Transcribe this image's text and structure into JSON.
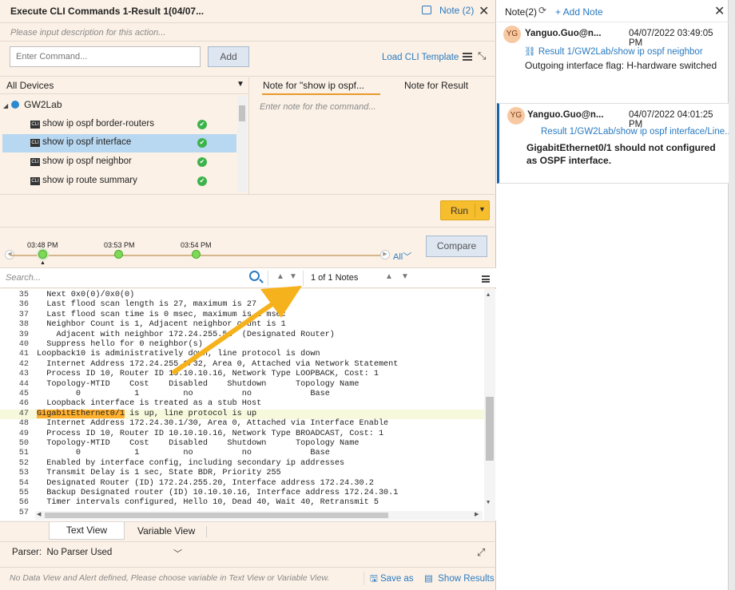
{
  "window": {
    "title": "Execute CLI Commands 1-Result 1(04/07...",
    "note_button": "Note (2)"
  },
  "description_placeholder": "Please input description for this action...",
  "command": {
    "placeholder": "Enter Command...",
    "add_label": "Add",
    "load_template": "Load CLI Template"
  },
  "devices": {
    "dropdown_label": "All Devices",
    "root": "GW2Lab",
    "items": [
      {
        "label": "show ip ospf border-routers",
        "selected": false
      },
      {
        "label": "show ip ospf interface",
        "selected": true
      },
      {
        "label": "show ip ospf neighbor",
        "selected": false
      },
      {
        "label": "show ip route summary",
        "selected": false
      }
    ]
  },
  "note_tabs": {
    "tab1": "Note for \"show ip ospf...",
    "tab2": "Note for Result",
    "placeholder": "Enter note for the command..."
  },
  "run_label": "Run",
  "timeline": {
    "times": [
      "03:48 PM",
      "03:53 PM",
      "03:54 PM"
    ],
    "all_label": "All"
  },
  "compare_label": "Compare",
  "search": {
    "placeholder": "Search...",
    "notes_count": "1 of 1 Notes"
  },
  "code_lines": [
    {
      "n": "35",
      "t": "  Next 0x0(0)/0x0(0)"
    },
    {
      "n": "36",
      "t": "  Last flood scan length is 27, maximum is 27"
    },
    {
      "n": "37",
      "t": "  Last flood scan time is 0 msec, maximum is 2 msec"
    },
    {
      "n": "38",
      "t": "  Neighbor Count is 1, Adjacent neighbor count is 1"
    },
    {
      "n": "39",
      "t": "    Adjacent with neighbor 172.24.255.51  (Designated Router)"
    },
    {
      "n": "40",
      "t": "  Suppress hello for 0 neighbor(s)"
    },
    {
      "n": "41",
      "t": "Loopback10 is administratively down, line protocol is down"
    },
    {
      "n": "42",
      "t": "  Internet Address 172.24.255.1/32, Area 0, Attached via Network Statement"
    },
    {
      "n": "43",
      "t": "  Process ID 10, Router ID 10.10.10.16, Network Type LOOPBACK, Cost: 1"
    },
    {
      "n": "44",
      "t": "  Topology-MTID    Cost    Disabled    Shutdown      Topology Name"
    },
    {
      "n": "45",
      "t": "        0           1         no          no            Base"
    },
    {
      "n": "46",
      "t": "  Loopback interface is treated as a stub Host"
    },
    {
      "n": "47",
      "t": " is up, line protocol is up",
      "hw": "GigabitEthernet0/1"
    },
    {
      "n": "48",
      "t": "  Internet Address 172.24.30.1/30, Area 0, Attached via Interface Enable"
    },
    {
      "n": "49",
      "t": "  Process ID 10, Router ID 10.10.10.16, Network Type BROADCAST, Cost: 1"
    },
    {
      "n": "50",
      "t": "  Topology-MTID    Cost    Disabled    Shutdown      Topology Name"
    },
    {
      "n": "51",
      "t": "        0           1         no          no            Base"
    },
    {
      "n": "52",
      "t": "  Enabled by interface config, including secondary ip addresses"
    },
    {
      "n": "53",
      "t": "  Transmit Delay is 1 sec, State BDR, Priority 255"
    },
    {
      "n": "54",
      "t": "  Designated Router (ID) 172.24.255.20, Interface address 172.24.30.2"
    },
    {
      "n": "55",
      "t": "  Backup Designated router (ID) 10.10.10.16, Interface address 172.24.30.1"
    },
    {
      "n": "56",
      "t": "  Timer intervals configured, Hello 10, Dead 40, Wait 40, Retransmit 5"
    },
    {
      "n": "57",
      "t": ""
    }
  ],
  "view_tabs": {
    "text_view": "Text View",
    "variable_view": "Variable View"
  },
  "parser": {
    "label": "Parser:",
    "value": "No Parser Used"
  },
  "footer": {
    "message": "No Data View and Alert defined, Please choose variable in Text View or Variable View.",
    "save_as": "Save as",
    "show_results": "Show Results"
  },
  "notes_panel": {
    "title": "Note(2)",
    "add_note": "+ Add Note",
    "notes": [
      {
        "initials": "YG",
        "user": "Yanguo.Guo@n...",
        "date": "04/07/2022 03:49:05 PM",
        "link": "Result 1/GW2Lab/show ip ospf neighbor",
        "text": "Outgoing interface flag: H-hardware switched"
      },
      {
        "initials": "YG",
        "user": "Yanguo.Guo@n...",
        "date": "04/07/2022 04:01:25 PM",
        "link": "Result 1/GW2Lab/show ip ospf interface/Line...",
        "text1": "GigabitEthernet0/1 should not configured",
        "text2": "as OSPF interface."
      }
    ]
  },
  "colors": {
    "accent": "#2a7ac0",
    "run": "#f6bd2c",
    "highlight": "#ffb02e",
    "arrow": "#f6b21c"
  }
}
